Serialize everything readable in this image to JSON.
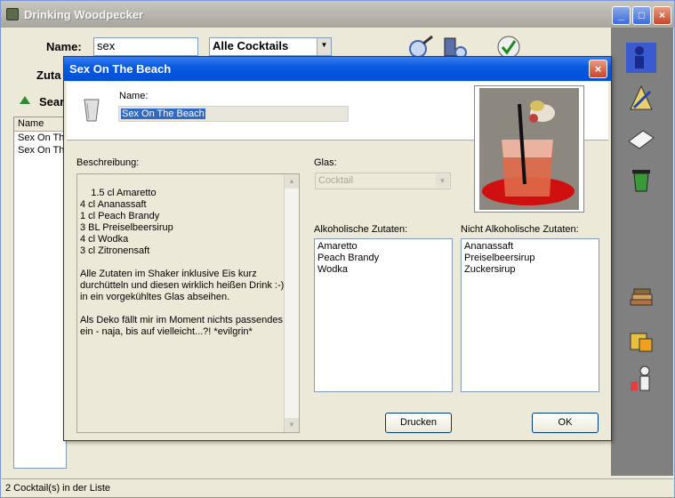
{
  "main_window": {
    "title": "Drinking Woodpecker",
    "minimize": "_",
    "maximize": "□",
    "close": "×",
    "name_label": "Name:",
    "name_value": "sex",
    "category_value": "Alle Cocktails",
    "zutaten_label": "Zuta",
    "search_label": "Sear",
    "list_header": "Name",
    "list_rows": [
      "Sex On The",
      "Sex On The"
    ],
    "status": "2 Cocktail(s) in der Liste"
  },
  "dialog": {
    "title": "Sex On The Beach",
    "close": "×",
    "name_label": "Name:",
    "name_value": "Sex On The Beach",
    "beschreibung_label": "Beschreibung:",
    "beschreibung_text": "1.5 cl Amaretto\n4 cl Ananassaft\n1 cl Peach Brandy\n3 BL Preiselbeersirup\n4 cl Wodka\n3 cl Zitronensaft\n\nAlle Zutaten im Shaker inklusive Eis kurz\ndurchütteln und diesen wirklich heißen Drink :-)\nin ein vorgekühltes Glas abseihen.\n\nAls Deko fällt mir im Moment nichts passendes\nein - naja, bis auf vielleicht...?! *evilgrin*",
    "glas_label": "Glas:",
    "glas_value": "Cocktail",
    "alkoholisch_label": "Alkoholische Zutaten:",
    "alkoholisch_items": "Amaretto\nPeach Brandy\nWodka",
    "nicht_alkoholisch_label": "Nicht Alkoholische Zutaten:",
    "nicht_alkoholisch_items": "Ananassaft\nPreiselbeersirup\nZuckersirup",
    "drucken_button": "Drucken",
    "ok_button": "OK"
  },
  "colors": {
    "dialog_title": "#0a5ae0",
    "sidebar": "#808080",
    "selection": "#316ac5"
  }
}
